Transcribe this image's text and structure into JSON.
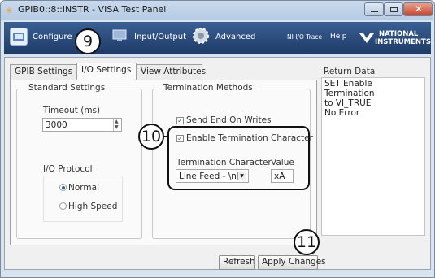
{
  "window": {
    "title": "GPIB0::8::INSTR - VISA Test Panel",
    "controls": [
      "minimize",
      "maximize",
      "close"
    ]
  },
  "toolbar": {
    "items": [
      {
        "label": "Configure",
        "icon": "configure-icon"
      },
      {
        "label": "Input/Output",
        "icon": "input-output-icon"
      },
      {
        "label": "Advanced",
        "icon": "advanced-gear-icon"
      },
      {
        "label": "NI I/O Trace"
      },
      {
        "label": "Help"
      }
    ],
    "brand": {
      "line1": "NATIONAL",
      "line2": "INSTRUMENTS"
    }
  },
  "tabs": [
    {
      "label": "GPIB Settings",
      "active": false
    },
    {
      "label": "I/O Settings",
      "active": true
    },
    {
      "label": "View Attributes",
      "active": false
    }
  ],
  "standard_settings": {
    "group_label": "Standard Settings",
    "timeout_label": "Timeout (ms)",
    "timeout_value": "3000",
    "io_protocol_label": "I/O Protocol",
    "protocol_options": [
      {
        "label": "Normal",
        "selected": true
      },
      {
        "label": "High Speed",
        "selected": false
      }
    ]
  },
  "termination": {
    "group_label": "Termination Methods",
    "send_end_label": "Send End On Writes",
    "send_end_checked": true,
    "enable_term_label": "Enable Termination Character",
    "enable_term_checked": true,
    "term_char_label": "Termination Character",
    "term_char_value": "Line Feed - \\n",
    "value_label": "Value",
    "value_value": "xA"
  },
  "return_data": {
    "label": "Return Data",
    "lines": [
      "SET Enable Termination",
      "to VI_TRUE",
      "No Error"
    ]
  },
  "buttons": {
    "refresh": "Refresh",
    "apply": "Apply Changes"
  },
  "callouts": [
    "9",
    "10",
    "11"
  ],
  "colors": {
    "toolbar": "#2a4a7c",
    "accent": "#2b5fa8"
  }
}
